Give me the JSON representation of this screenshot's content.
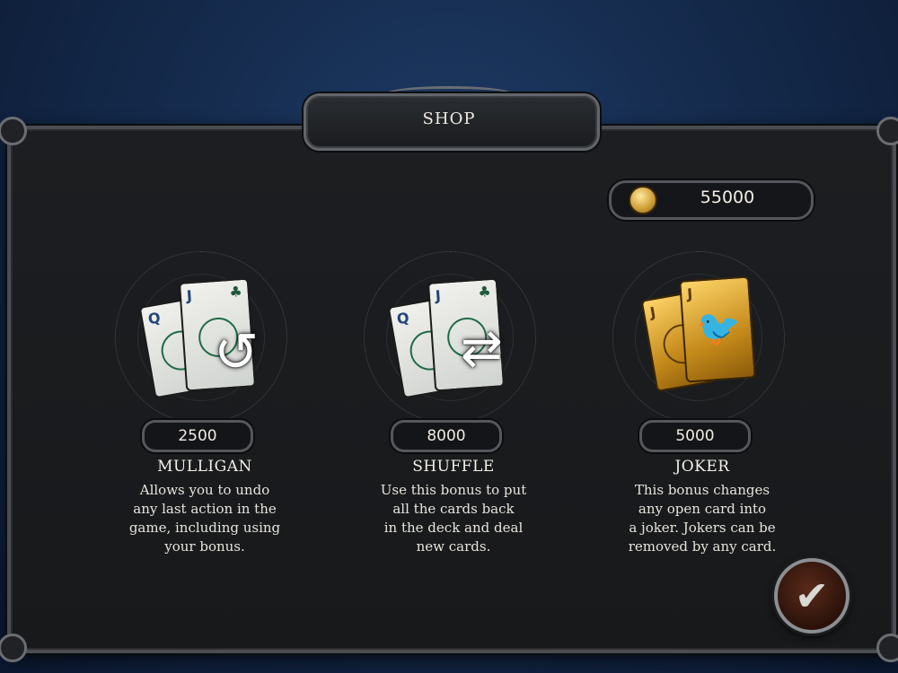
{
  "header": {
    "title": "SHOP"
  },
  "wallet": {
    "coins": "55000",
    "icon": "coin-icon"
  },
  "items": [
    {
      "title": "MULLIGAN",
      "price": "2500",
      "description": "Allows you to undo\nany last action in the\ngame, including using\nyour bonus.",
      "cards": [
        "Q",
        "J"
      ],
      "icon": "undo-arrow-icon"
    },
    {
      "title": "SHUFFLE",
      "price": "8000",
      "description": "Use this bonus to put\nall the cards back\nin the deck and deal\nnew cards.",
      "cards": [
        "Q",
        "J"
      ],
      "icon": "shuffle-arrows-icon"
    },
    {
      "title": "JOKER",
      "price": "5000",
      "description": "This bonus changes\nany open card into\na joker. Jokers can be\nremoved by any card.",
      "cards": [
        "J",
        "J"
      ],
      "icon": "raven-icon"
    }
  ],
  "confirm": {
    "icon": "checkmark-icon"
  },
  "colors": {
    "accent_gold": "#d1a23a",
    "background": "#132747",
    "panel": "#1c1e21"
  }
}
